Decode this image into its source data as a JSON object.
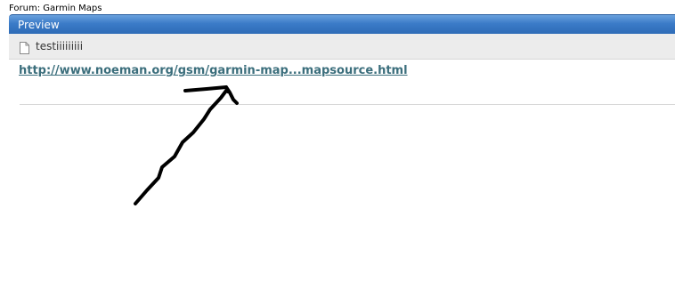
{
  "forum": {
    "label": "Forum: Garmin Maps"
  },
  "preview": {
    "title": "Preview"
  },
  "post": {
    "subject": "testiiiiiiiii",
    "link_text": "http://www.noeman.org/gsm/garmin-map...mapsource.html"
  },
  "icons": {
    "subject": "document-icon",
    "annotation": "hand-drawn-arrow"
  }
}
